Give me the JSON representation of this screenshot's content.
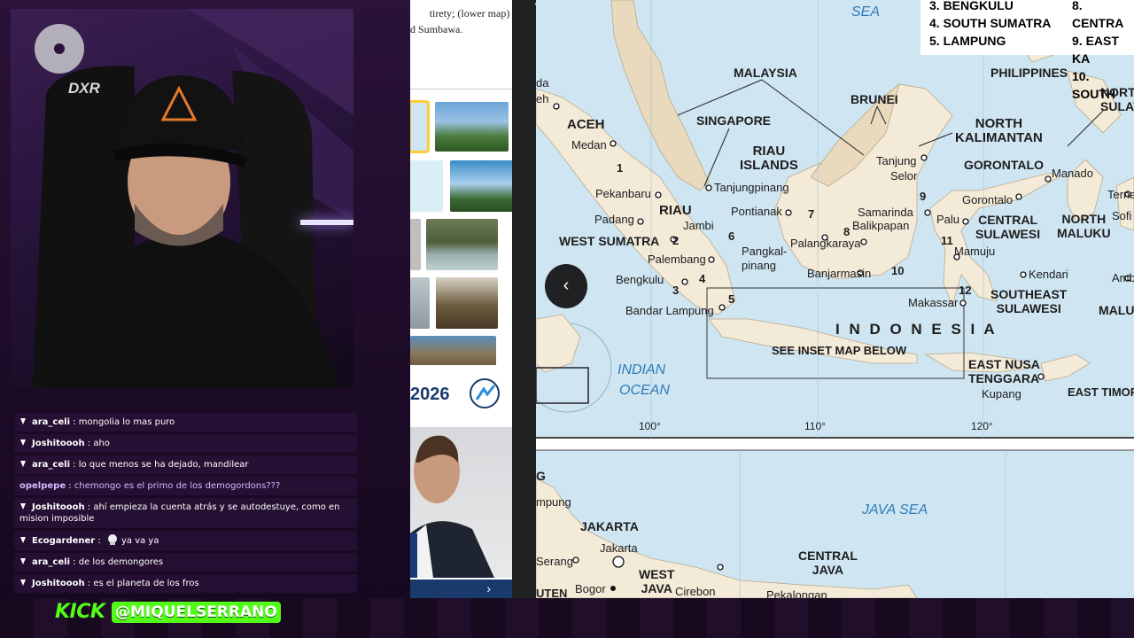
{
  "article": {
    "text_line1": "tirety; (lower map) the",
    "text_line2": "d Sumbawa."
  },
  "ad": {
    "year": "2026",
    "next_icon": "chevron-right-icon"
  },
  "chat": [
    {
      "user": "ara_celi",
      "message": "mongolia lo mas puro",
      "style": "normal"
    },
    {
      "user": "Joshitoooh",
      "message": "aho",
      "style": "normal"
    },
    {
      "user": "ara_celi",
      "message": "lo que menos se ha dejado, mandilear",
      "style": "normal"
    },
    {
      "user": "opelpepe",
      "message": "chemongo es el primo de los demogordons???",
      "style": "purple"
    },
    {
      "user": "Joshitoooh",
      "message": "ahí empieza la cuenta atrás y se autodestuye, como en mision imposible",
      "style": "normal"
    },
    {
      "user": "Ecogardener",
      "message": "ya va ya",
      "style": "normal"
    },
    {
      "user": "ara_celi",
      "message": "de los demongores",
      "style": "normal"
    },
    {
      "user": "Joshitoooh",
      "message": "es el planeta de los fros",
      "style": "normal"
    }
  ],
  "branding": {
    "platform": "KICK",
    "handle": "@MIQUELSERRANO",
    "platform_color": "#53fc18"
  },
  "map": {
    "legend": {
      "col1": [
        "3. BENGKULU",
        "4. SOUTH SUMATRA",
        "5. LAMPUNG"
      ],
      "col2": [
        "8. CENTRA",
        "9. EAST KA",
        "10. SOUTH"
      ]
    },
    "seas": {
      "top": "SEA",
      "indian1": "INDIAN",
      "indian2": "OCEAN",
      "java": "JAVA SEA"
    },
    "country": "I N D O N E S I A",
    "inset_note": "SEE INSET MAP BELOW",
    "degrees": [
      "100°",
      "110°",
      "120°"
    ],
    "regions": {
      "malaysia": "MALAYSIA",
      "brunei": "BRUNEI",
      "philippines": "PHILIPPINES",
      "singapore": "SINGAPORE",
      "aceh": "ACEH",
      "riau_islands1": "RIAU",
      "riau_islands2": "ISLANDS",
      "riau": "RIAU",
      "west_sumatra": "WEST SUMATRA",
      "north_kal1": "NORTH",
      "north_kal2": "KALIMANTAN",
      "gorontalo": "GORONTALO",
      "central_sul1": "CENTRAL",
      "central_sul2": "SULAWESI",
      "north_maluku1": "NORTH",
      "north_maluku2": "MALUKU",
      "se_sul1": "SOUTHEAST",
      "se_sul2": "SULAWESI",
      "north_sul1": "NORT",
      "north_sul2": "SULAV",
      "maluku": "MALU",
      "ent1": "EAST NUSA",
      "ent2": "TENGGARA",
      "east_timor": "EAST TIMOR",
      "jakarta": "JAKARTA",
      "west_java1": "WEST",
      "west_java2": "JAVA",
      "central_java1": "CENTRAL",
      "central_java2": "JAVA",
      "corner_g": "G"
    },
    "cities": {
      "medan": "Medan",
      "aceh_city": "eh",
      "pekanbaru": "Pekanbaru",
      "padang": "Padang",
      "jambi": "Jambi",
      "palembang": "Palembang",
      "bengkulu": "Bengkulu",
      "bandar": "Bandar Lampung",
      "tanjungpinang": "Tanjungpinang",
      "pontianak": "Pontianak",
      "pangkal1": "Pangkal-",
      "pangkal2": "pinang",
      "palangkaraya": "Palangkaraya",
      "banjarmasin": "Banjarmasin",
      "samarinda": "Samarinda",
      "balikpapan": "Balikpapan",
      "tanjung1": "Tanjung",
      "tanjung2": "Selor",
      "gorontalo_city": "Gorontalo",
      "manado": "Manado",
      "ternate": "Ternate",
      "sofifi": "Sofi",
      "palu": "Palu",
      "mamuju": "Mamuju",
      "kendari": "Kendari",
      "makassar": "Makassar",
      "kupang": "Kupang",
      "ambon": "Amb",
      "da": "da",
      "jakarta_city": "Jakarta",
      "serang": "Serang",
      "bogor": "Bogor",
      "cirebon": "Cirebon",
      "pekalongan": "Pekalongan",
      "lampung_frag": "mpung",
      "unten": "UTEN"
    },
    "numbers": [
      "1",
      "2",
      "3",
      "4",
      "5",
      "6",
      "7",
      "8",
      "9",
      "10",
      "11",
      "12"
    ]
  }
}
